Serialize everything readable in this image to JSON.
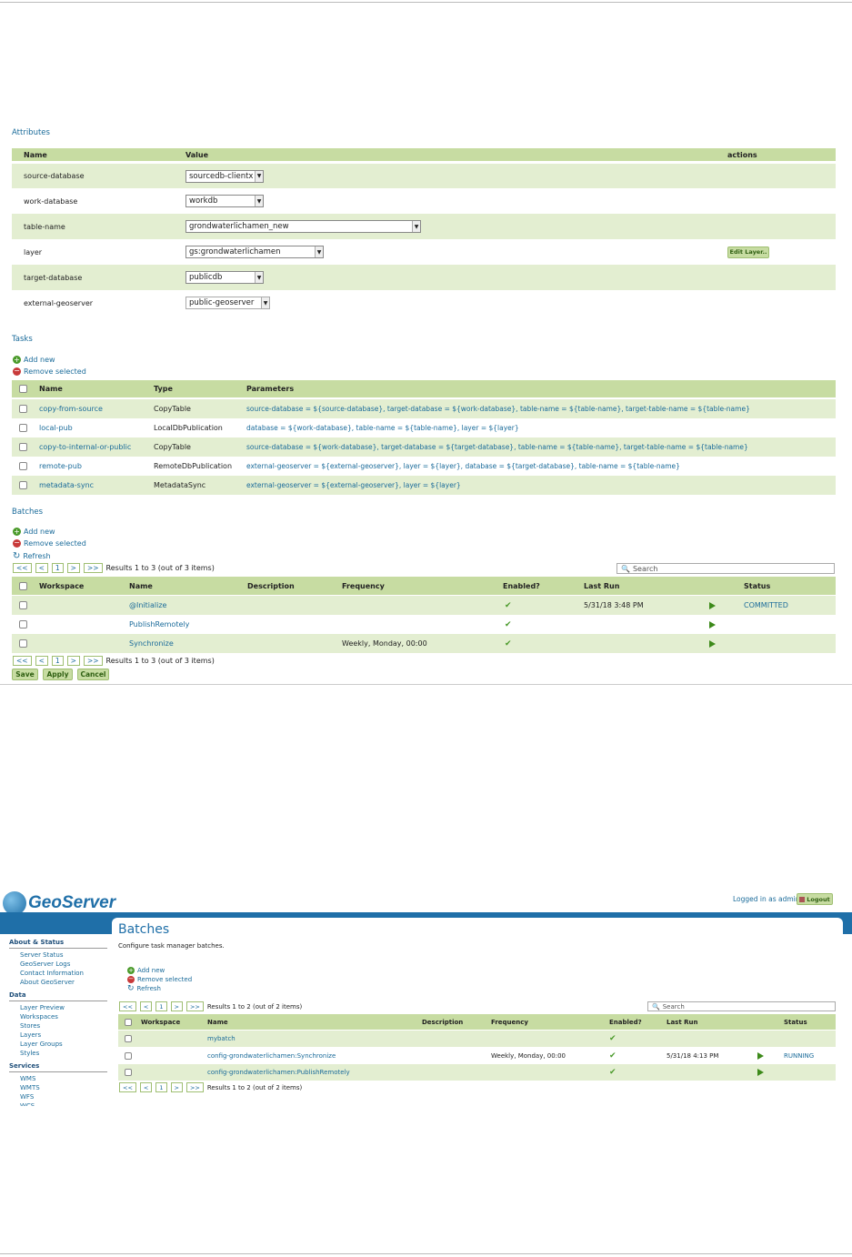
{
  "attributes": {
    "title": "Attributes",
    "headers": {
      "name": "Name",
      "value": "Value",
      "actions": "actions"
    },
    "rows": [
      {
        "name": "source-database",
        "value": "sourcedb-clientx"
      },
      {
        "name": "work-database",
        "value": "workdb"
      },
      {
        "name": "table-name",
        "value": "grondwaterlichamen_new"
      },
      {
        "name": "layer",
        "value": "gs:grondwaterlichamen",
        "action": "Edit Layer.."
      },
      {
        "name": "target-database",
        "value": "publicdb"
      },
      {
        "name": "external-geoserver",
        "value": "public-geoserver"
      }
    ]
  },
  "tasks": {
    "title": "Tasks",
    "add_new": "Add new",
    "remove_selected": "Remove selected",
    "headers": {
      "name": "Name",
      "type": "Type",
      "parameters": "Parameters"
    },
    "rows": [
      {
        "name": "copy-from-source",
        "type": "CopyTable",
        "params": "source-database = ${source-database}, target-database = ${work-database}, table-name = ${table-name}, target-table-name = ${table-name}"
      },
      {
        "name": "local-pub",
        "type": "LocalDbPublication",
        "params": "database = ${work-database}, table-name = ${table-name}, layer = ${layer}"
      },
      {
        "name": "copy-to-internal-or-public",
        "type": "CopyTable",
        "params": "source-database = ${work-database}, target-database = ${target-database}, table-name = ${table-name}, target-table-name = ${table-name}"
      },
      {
        "name": "remote-pub",
        "type": "RemoteDbPublication",
        "params": "external-geoserver = ${external-geoserver}, layer = ${layer}, database = ${target-database}, table-name = ${table-name}"
      },
      {
        "name": "metadata-sync",
        "type": "MetadataSync",
        "params": "external-geoserver = ${external-geoserver}, layer = ${layer}"
      }
    ]
  },
  "batches1": {
    "title": "Batches",
    "add_new": "Add new",
    "remove_selected": "Remove selected",
    "refresh": "Refresh",
    "pager": {
      "first": "<<",
      "prev": "<",
      "page": "1",
      "next": ">",
      "last": ">>",
      "results": "Results 1 to 3 (out of 3 items)"
    },
    "search_placeholder": "Search",
    "headers": {
      "workspace": "Workspace",
      "name": "Name",
      "description": "Description",
      "frequency": "Frequency",
      "enabled": "Enabled?",
      "last_run": "Last Run",
      "status": "Status"
    },
    "rows": [
      {
        "name": "@Initialize",
        "frequency": "",
        "enabled": "✔",
        "last_run": "5/31/18 3:48 PM",
        "status": "COMMITTED"
      },
      {
        "name": "PublishRemotely",
        "frequency": "",
        "enabled": "✔",
        "last_run": "",
        "status": ""
      },
      {
        "name": "Synchronize",
        "frequency": "Weekly, Monday, 00:00",
        "enabled": "✔",
        "last_run": "",
        "status": ""
      }
    ],
    "buttons": {
      "save": "Save",
      "apply": "Apply",
      "cancel": "Cancel"
    }
  },
  "geoserver": {
    "logo": "GeoServer",
    "logged_in": "Logged in as admin.",
    "logout": "Logout",
    "sidebar": [
      {
        "heading": "About & Status",
        "items": [
          "Server Status",
          "GeoServer Logs",
          "Contact Information",
          "About GeoServer"
        ]
      },
      {
        "heading": "Data",
        "items": [
          "Layer Preview",
          "Workspaces",
          "Stores",
          "Layers",
          "Layer Groups",
          "Styles"
        ]
      },
      {
        "heading": "Services",
        "items": [
          "WMS",
          "WMTS",
          "WFS",
          "WCS"
        ]
      }
    ],
    "page_title": "Batches",
    "page_desc": "Configure task manager batches.",
    "add_new": "Add new",
    "remove_selected": "Remove selected",
    "refresh": "Refresh",
    "pager": {
      "first": "<<",
      "prev": "<",
      "page": "1",
      "next": ">",
      "last": ">>",
      "results": "Results 1 to 2 (out of 2 items)"
    },
    "search_placeholder": "Search",
    "headers": {
      "workspace": "Workspace",
      "name": "Name",
      "description": "Description",
      "frequency": "Frequency",
      "enabled": "Enabled?",
      "last_run": "Last Run",
      "status": "Status"
    },
    "rows": [
      {
        "name": "mybatch",
        "frequency": "",
        "enabled": "✔",
        "last_run": "",
        "status": ""
      },
      {
        "name": "config-grondwaterlichamen:Synchronize",
        "frequency": "Weekly, Monday, 00:00",
        "enabled": "✔",
        "last_run": "5/31/18 4:13 PM",
        "status": "RUNNING"
      },
      {
        "name": "config-grondwaterlichamen:PublishRemotely",
        "frequency": "",
        "enabled": "✔",
        "last_run": "",
        "status": ""
      }
    ]
  }
}
